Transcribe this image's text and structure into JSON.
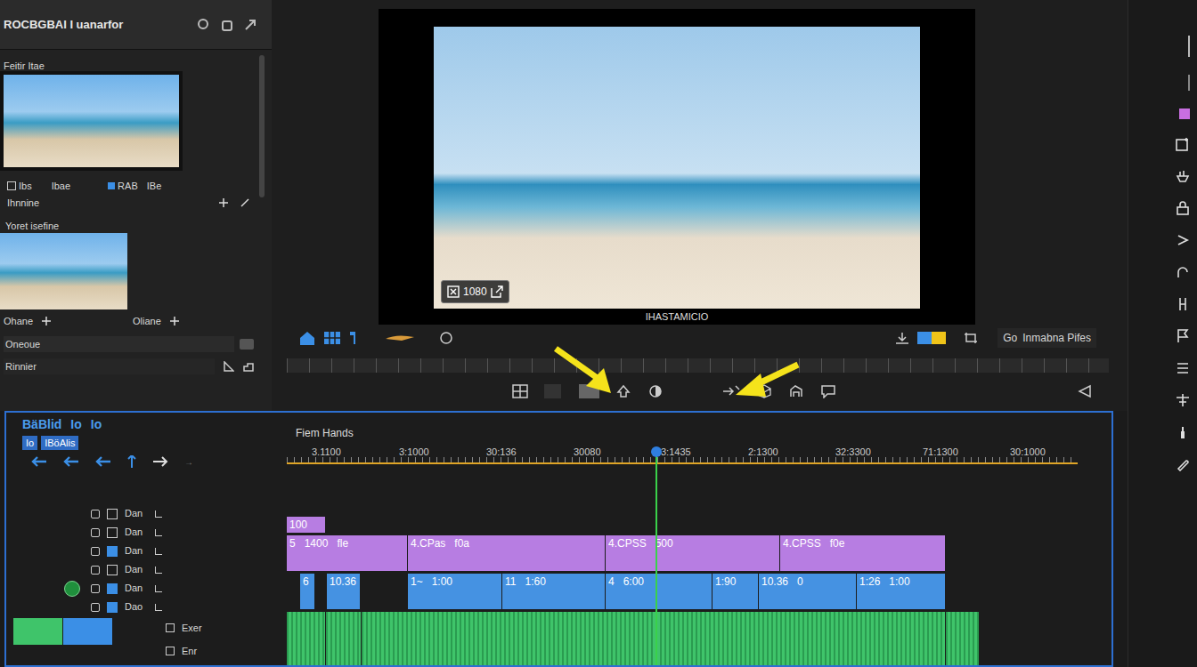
{
  "app": {
    "title": "ROCBGBAI I uanarfor"
  },
  "left_panel": {
    "section1": "Feitir Itae",
    "section1_labels": [
      "Ibs",
      "Ibae",
      "RAB",
      "IBe"
    ],
    "section1_sub": "Ihnnine",
    "section2": "Yoret isefine",
    "section2_labels": [
      "Ohane",
      "Oliane"
    ],
    "fields": [
      {
        "label": "Oneoue"
      },
      {
        "label": "Rinnier"
      }
    ]
  },
  "viewer": {
    "badge": "1080",
    "caption": "IHASTAMICIO"
  },
  "toolbar": {
    "go": "Go",
    "label": "Inmabna Pifes"
  },
  "timeline": {
    "title": "BäBlid",
    "tabs": [
      "Io",
      "Io"
    ],
    "sub_tab": "IBöAlis",
    "track_name": "Fiem Hands",
    "ruler": [
      "3.1100",
      "3:1000",
      "30:136",
      "30080",
      "3:1435",
      "2:1300",
      "32:3300",
      "71:1300",
      "30:1000"
    ],
    "playhead": 414,
    "length": 888,
    "track_headers": [
      "Dan",
      "Dan",
      "Dan",
      "Dan",
      "Dan",
      "Dao"
    ],
    "audio_headers": [
      "Exer",
      "Enr"
    ],
    "tracks": [
      {
        "kind": "marker",
        "color": "#b77de2",
        "clips": [
          {
            "start": 0,
            "end": 44,
            "texts": [
              "100"
            ]
          }
        ]
      },
      {
        "kind": "video",
        "color": "#b77de2",
        "clips": [
          {
            "start": 0,
            "end": 136,
            "texts": [
              "5",
              "1400",
              "fle"
            ]
          },
          {
            "start": 136,
            "end": 358,
            "texts": [
              "4.CPas",
              "f0a"
            ]
          },
          {
            "start": 358,
            "end": 554,
            "texts": [
              "4.CPSS",
              "500"
            ]
          },
          {
            "start": 554,
            "end": 740,
            "texts": [
              "4.CPSS",
              "f0e"
            ]
          }
        ]
      },
      {
        "kind": "video",
        "color": "#4592e2",
        "clips": [
          {
            "start": 15,
            "end": 32,
            "texts": [
              "6"
            ]
          },
          {
            "start": 45,
            "end": 83,
            "texts": [
              "10.36"
            ]
          },
          {
            "start": 136,
            "end": 242,
            "texts": [
              "1~",
              "1:00"
            ]
          },
          {
            "start": 242,
            "end": 358,
            "texts": [
              "11",
              "1:60"
            ]
          },
          {
            "start": 358,
            "end": 478,
            "texts": [
              "4",
              "6:00"
            ]
          },
          {
            "start": 478,
            "end": 530,
            "texts": [
              "1:90"
            ]
          },
          {
            "start": 530,
            "end": 640,
            "texts": [
              "10.36",
              "0"
            ]
          },
          {
            "start": 640,
            "end": 740,
            "texts": [
              "1:26",
              "1:00"
            ]
          }
        ]
      },
      {
        "kind": "audio",
        "color": "#3fc46a",
        "clips": [
          {
            "start": 0,
            "end": 44,
            "texts": []
          },
          {
            "start": 44,
            "end": 84,
            "texts": []
          },
          {
            "start": 84,
            "end": 740,
            "texts": []
          },
          {
            "start": 740,
            "end": 778,
            "texts": []
          }
        ]
      }
    ]
  }
}
